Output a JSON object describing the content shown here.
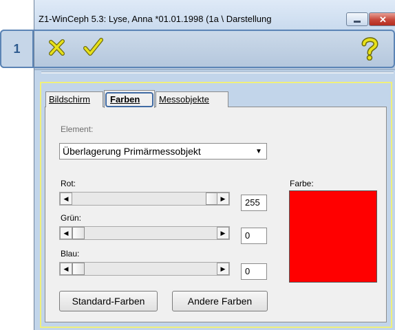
{
  "window": {
    "title": "Z1-WinCeph 5.3: Lyse, Anna *01.01.1998 (1a \\ Darstellung"
  },
  "callout": {
    "number": "1"
  },
  "toolbar": {
    "cancel_icon": "x-icon",
    "ok_icon": "checkmark-icon",
    "help_icon": "question-mark-icon"
  },
  "tabs": [
    {
      "label": "Bildschirm",
      "selected": false
    },
    {
      "label": "Farben",
      "selected": true
    },
    {
      "label": "Messobjekte",
      "selected": false
    }
  ],
  "element": {
    "label": "Element:",
    "selected": "Überlagerung Primärmessobjekt"
  },
  "sliders": {
    "red": {
      "label": "Rot:",
      "value": "255",
      "level": 255
    },
    "green": {
      "label": "Grün:",
      "value": "0",
      "level": 0
    },
    "blue": {
      "label": "Blau:",
      "value": "0",
      "level": 0
    }
  },
  "color": {
    "label": "Farbe:",
    "hex": "#ff0000"
  },
  "buttons": {
    "standard": "Standard-Farben",
    "other": "Andere Farben"
  }
}
